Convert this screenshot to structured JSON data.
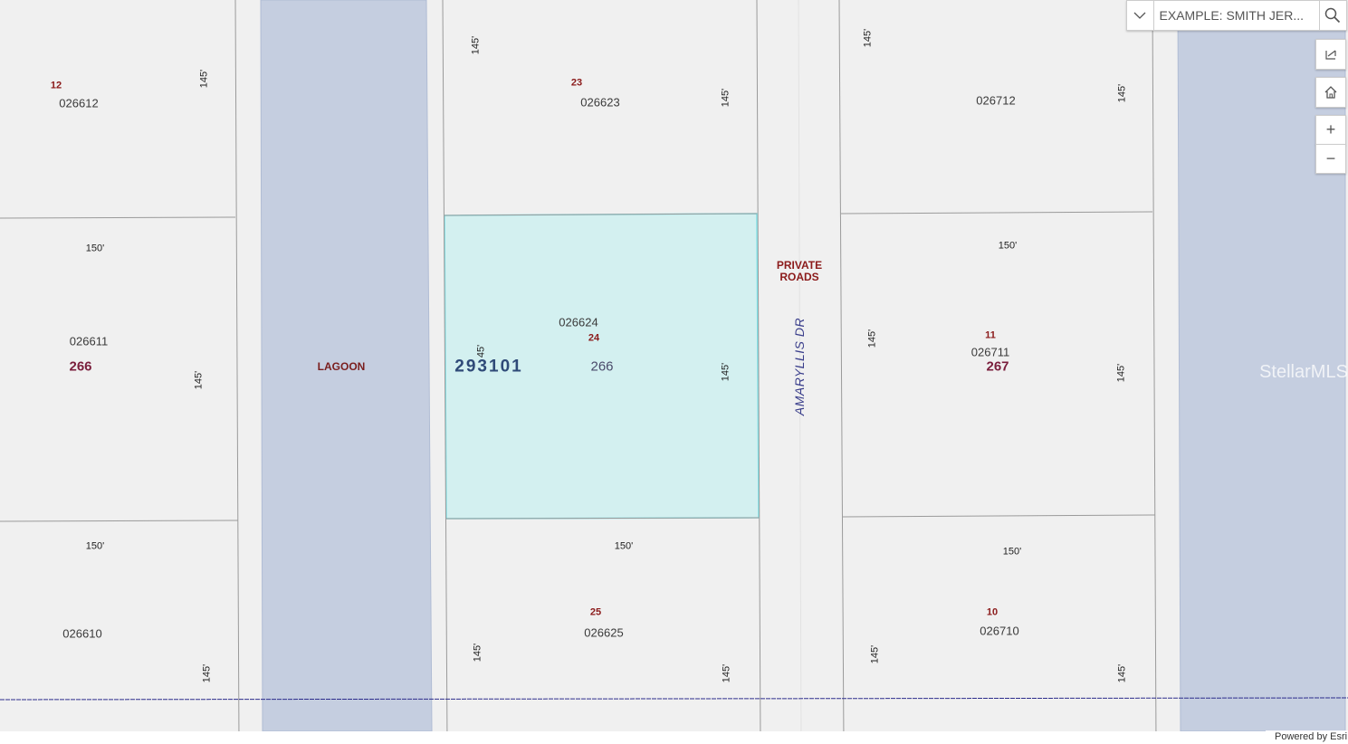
{
  "search": {
    "placeholder": "EXAMPLE: SMITH JER...",
    "dropdown_icon": "chevron-down-icon",
    "search_icon": "search-icon"
  },
  "controls": {
    "layers_icon": "layers-icon",
    "home_icon": "home-icon",
    "zoom_in": "+",
    "zoom_out": "−"
  },
  "colors": {
    "water": "#c5cee0",
    "selected_fill": "#d3f0f0",
    "selected_stroke": "#7fe0e6",
    "background": "#f0f0f0"
  },
  "features": {
    "lagoon": "LAGOON",
    "private_roads_line1": "PRIVATE",
    "private_roads_line2": "ROADS",
    "street": "AMARYLLIS DR",
    "subdivision": "293101"
  },
  "parcels": {
    "p026612": "026612",
    "lot12": "12",
    "p026611": "026611",
    "block266_left": "266",
    "p026610": "026610",
    "p026623": "026623",
    "lot23": "23",
    "p026624": "026624",
    "lot24": "24",
    "block266_mid": "266",
    "p026625": "026625",
    "lot25": "25",
    "p026712": "026712",
    "p026711": "026711",
    "lot11": "11",
    "block267": "267",
    "p026710": "026710",
    "lot10": "10"
  },
  "dims": {
    "d150": "150'",
    "d145": "145'",
    "d45": "45'"
  },
  "watermark": "StellarMLS",
  "attribution": "Powered by Esri"
}
